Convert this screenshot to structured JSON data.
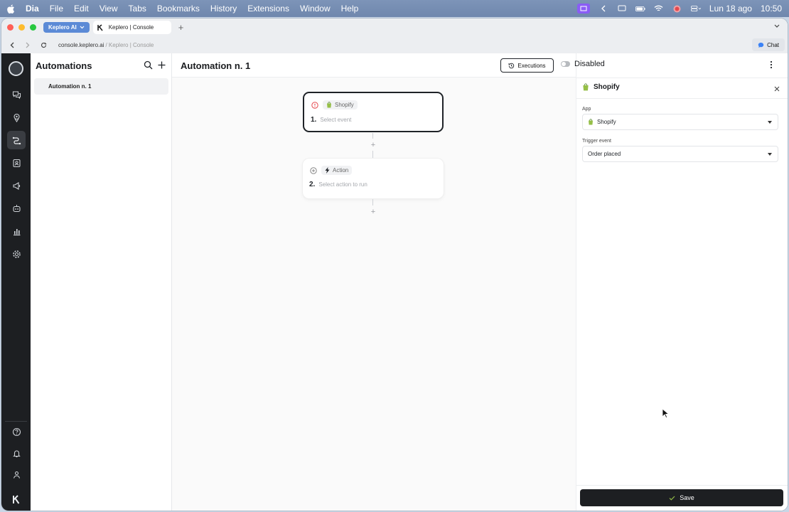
{
  "menubar": {
    "app_name": "Dia",
    "menus": [
      "File",
      "Edit",
      "View",
      "Tabs",
      "Bookmarks",
      "History",
      "Extensions",
      "Window",
      "Help"
    ],
    "date": "Lun 18 ago",
    "time": "10:50"
  },
  "browser": {
    "workspace": "Keplero AI",
    "tab_title": "Keplero | Console",
    "url": "console.keplero.ai",
    "url_title": "/ Keplero | Console",
    "chat_label": "Chat"
  },
  "sidebar": {
    "title": "Automations",
    "items": [
      {
        "label": "Automation n. 1"
      }
    ]
  },
  "main": {
    "title": "Automation n. 1",
    "trigger": {
      "app": "Shopify",
      "number": "1.",
      "placeholder": "Select event"
    },
    "action": {
      "app": "Action",
      "number": "2.",
      "placeholder": "Select action to run"
    }
  },
  "header": {
    "executions_label": "Executions",
    "status_label": "Disabled"
  },
  "panel": {
    "title": "Shopify",
    "app_label": "App",
    "app_value": "Shopify",
    "trigger_label": "Trigger event",
    "trigger_value": "Order placed",
    "save_label": "Save"
  },
  "colors": {
    "shopify_green": "#95bf47",
    "dark": "#1d1f22",
    "accent_blue": "#5b8ad6",
    "warning_red": "#e5484d"
  }
}
